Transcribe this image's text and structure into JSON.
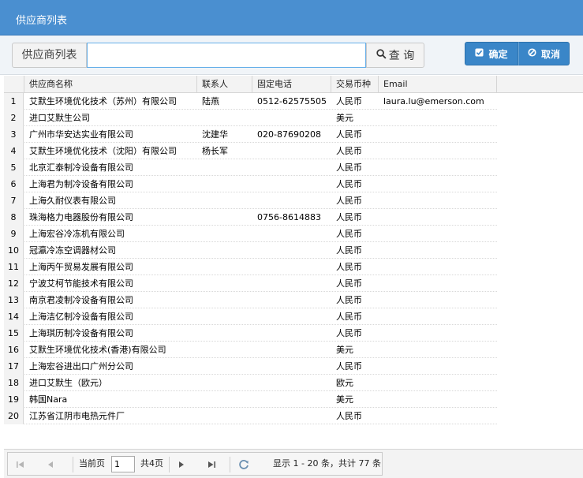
{
  "window": {
    "title": "供应商列表"
  },
  "search": {
    "label": "供应商列表",
    "value": "",
    "placeholder": "",
    "query_label": "查 询"
  },
  "actions": {
    "ok_label": "确定",
    "cancel_label": "取消"
  },
  "table": {
    "columns": [
      "供应商名称",
      "联系人",
      "固定电话",
      "交易币种",
      "Email"
    ],
    "rows": [
      {
        "n": "1",
        "name": "艾默生环境优化技术（苏州）有限公司",
        "contact": "陆燕",
        "phone": "0512-62575505",
        "currency": "人民币",
        "email": "laura.lu@emerson.com"
      },
      {
        "n": "2",
        "name": "进口艾默生公司",
        "contact": "",
        "phone": "",
        "currency": "美元",
        "email": ""
      },
      {
        "n": "3",
        "name": "广州市华安达实业有限公司",
        "contact": "沈建华",
        "phone": "020-87690208",
        "currency": "人民币",
        "email": ""
      },
      {
        "n": "4",
        "name": "艾默生环境优化技术（沈阳）有限公司",
        "contact": "杨长军",
        "phone": "",
        "currency": "人民币",
        "email": ""
      },
      {
        "n": "5",
        "name": "北京汇泰制冷设备有限公司",
        "contact": "",
        "phone": "",
        "currency": "人民币",
        "email": ""
      },
      {
        "n": "6",
        "name": "上海君为制冷设备有限公司",
        "contact": "",
        "phone": "",
        "currency": "人民币",
        "email": ""
      },
      {
        "n": "7",
        "name": "上海久耐仪表有限公司",
        "contact": "",
        "phone": "",
        "currency": "人民币",
        "email": ""
      },
      {
        "n": "8",
        "name": "珠海格力电器股份有限公司",
        "contact": "",
        "phone": "0756-8614883",
        "currency": "人民币",
        "email": ""
      },
      {
        "n": "9",
        "name": "上海宏谷冷冻机有限公司",
        "contact": "",
        "phone": "",
        "currency": "人民币",
        "email": ""
      },
      {
        "n": "10",
        "name": "冠瀛冷冻空调器材公司",
        "contact": "",
        "phone": "",
        "currency": "人民币",
        "email": ""
      },
      {
        "n": "11",
        "name": "上海丙午贸易发展有限公司",
        "contact": "",
        "phone": "",
        "currency": "人民币",
        "email": ""
      },
      {
        "n": "12",
        "name": "宁波艾柯节能技术有限公司",
        "contact": "",
        "phone": "",
        "currency": "人民币",
        "email": ""
      },
      {
        "n": "13",
        "name": "南京君凌制冷设备有限公司",
        "contact": "",
        "phone": "",
        "currency": "人民币",
        "email": ""
      },
      {
        "n": "14",
        "name": "上海洁亿制冷设备有限公司",
        "contact": "",
        "phone": "",
        "currency": "人民币",
        "email": ""
      },
      {
        "n": "15",
        "name": "上海琪历制冷设备有限公司",
        "contact": "",
        "phone": "",
        "currency": "人民币",
        "email": ""
      },
      {
        "n": "16",
        "name": "艾默生环境优化技术(香港)有限公司",
        "contact": "",
        "phone": "",
        "currency": "美元",
        "email": ""
      },
      {
        "n": "17",
        "name": "上海宏谷进出口广州分公司",
        "contact": "",
        "phone": "",
        "currency": "人民币",
        "email": ""
      },
      {
        "n": "18",
        "name": "进口艾默生（欧元）",
        "contact": "",
        "phone": "",
        "currency": "欧元",
        "email": ""
      },
      {
        "n": "19",
        "name": "韩国Nara",
        "contact": "",
        "phone": "",
        "currency": "美元",
        "email": ""
      },
      {
        "n": "20",
        "name": "江苏省江阴市电热元件厂",
        "contact": "",
        "phone": "",
        "currency": "人民币",
        "email": ""
      }
    ]
  },
  "pager": {
    "current_label": "当前页",
    "page_value": "1",
    "total_pages_label": "共4页",
    "summary": "显示 1 - 20 条，共计 77 条"
  },
  "icons": {
    "search": "search-icon",
    "ok": "check-square-icon",
    "cancel": "ban-icon",
    "first": "first-page-icon",
    "prev": "prev-page-icon",
    "next": "next-page-icon",
    "last": "last-page-icon",
    "refresh": "refresh-icon"
  },
  "colors": {
    "header": "#4a8fd0",
    "primary_button": "#3a86c8",
    "input_focus": "#66afe9"
  }
}
